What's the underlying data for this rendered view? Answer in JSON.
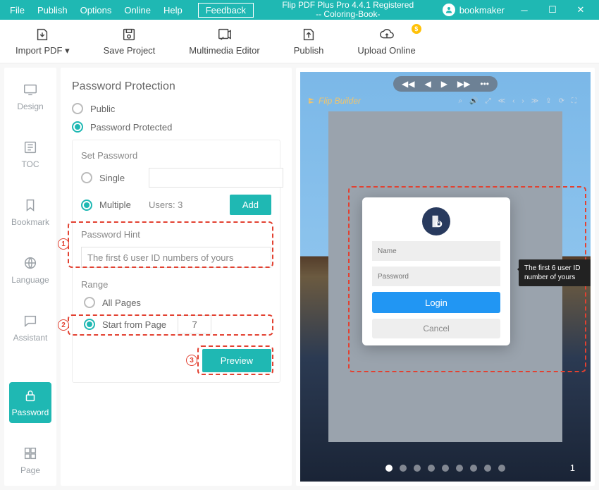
{
  "menubar": {
    "items": [
      "File",
      "Publish",
      "Options",
      "Online",
      "Help"
    ],
    "feedback": "Feedback"
  },
  "window": {
    "title_line1": "Flip PDF Plus Pro 4.4.1 Registered",
    "title_line2": "-- Coloring-Book-"
  },
  "user": {
    "name": "bookmaker"
  },
  "toolbar": {
    "import": "Import PDF ▾",
    "save": "Save Project",
    "multimedia": "Multimedia Editor",
    "publish": "Publish",
    "upload": "Upload Online",
    "upload_badge": "$"
  },
  "sidebar": {
    "design": "Design",
    "toc": "TOC",
    "bookmark": "Bookmark",
    "language": "Language",
    "assistant": "Assistant",
    "password": "Password",
    "page": "Page"
  },
  "panel": {
    "heading": "Password Protection",
    "public": "Public",
    "protected": "Password Protected",
    "set_password": "Set Password",
    "single": "Single",
    "multiple": "Multiple",
    "users_label": "Users: 3",
    "add": "Add",
    "hint_label": "Password Hint",
    "hint_value": "The first 6 user ID numbers of yours",
    "range": "Range",
    "all_pages": "All Pages",
    "start_from": "Start from Page",
    "start_page_value": "7",
    "preview": "Preview"
  },
  "annotations": {
    "n1": "1",
    "n2": "2",
    "n3": "3"
  },
  "preview": {
    "brand": "Flip Builder",
    "login_name_ph": "Name",
    "login_pass_ph": "Password",
    "login_btn": "Login",
    "cancel_btn": "Cancel",
    "tooltip": "The first 6 user ID number of yours",
    "page_number": "1"
  }
}
